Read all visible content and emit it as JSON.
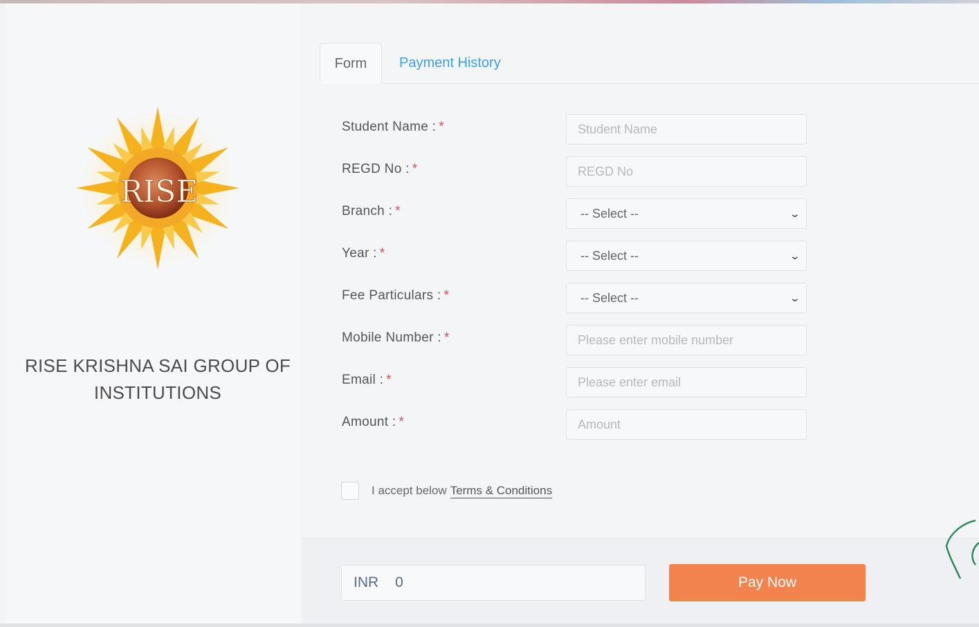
{
  "org": {
    "logo_text": "RISE",
    "name_line1": "RISE KRISHNA SAI GROUP OF",
    "name_line2": "INSTITUTIONS"
  },
  "tabs": [
    {
      "label": "Form",
      "active": true
    },
    {
      "label": "Payment History",
      "active": false
    }
  ],
  "form": {
    "required_marker": "*",
    "fields": [
      {
        "label": "Student Name :",
        "type": "text",
        "placeholder": "Student Name"
      },
      {
        "label": "REGD No :",
        "type": "text",
        "placeholder": "REGD No"
      },
      {
        "label": "Branch :",
        "type": "select",
        "value": "-- Select --"
      },
      {
        "label": "Year :",
        "type": "select",
        "value": "-- Select --"
      },
      {
        "label": "Fee Particulars :",
        "type": "select",
        "value": "-- Select --"
      },
      {
        "label": "Mobile Number :",
        "type": "text",
        "placeholder": "Please enter mobile number"
      },
      {
        "label": "Email :",
        "type": "text",
        "placeholder": "Please enter email"
      },
      {
        "label": "Amount :",
        "type": "text",
        "placeholder": "Amount"
      }
    ]
  },
  "terms": {
    "text": "I accept below",
    "link": "Terms & Conditions"
  },
  "payment": {
    "currency": "INR",
    "amount": "0",
    "button_label": "Pay Now"
  },
  "icons": {
    "chevron": "chevron-down-icon"
  },
  "colors": {
    "accent": "#f2834f",
    "link": "#3aa0e8",
    "required": "#e24b4b"
  }
}
